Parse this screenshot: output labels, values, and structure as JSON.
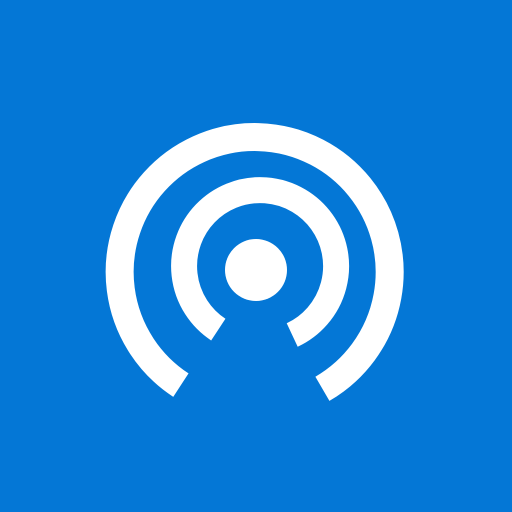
{
  "icon": {
    "name": "broadcast-antenna-icon",
    "background_color": "#0477d6",
    "foreground_color": "#ffffff"
  }
}
